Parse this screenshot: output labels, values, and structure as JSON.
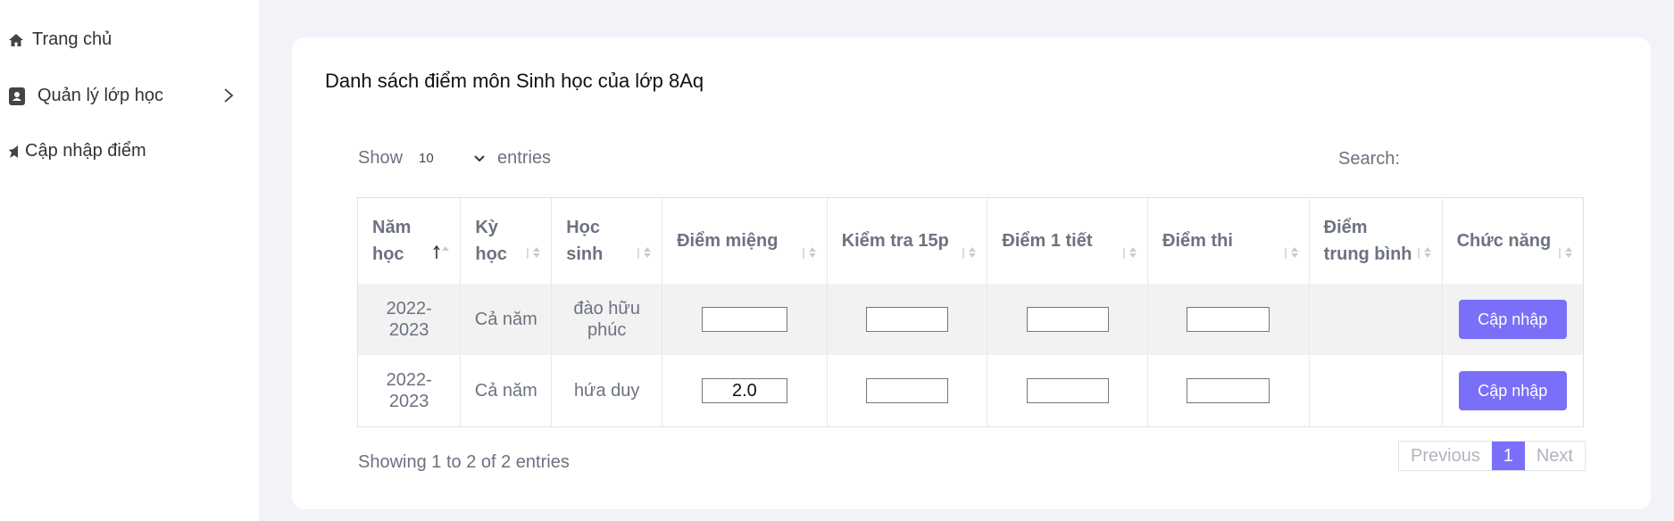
{
  "sidebar": {
    "items": [
      {
        "label": "Trang chủ",
        "icon": "home-icon"
      },
      {
        "label": "Quản lý lớp học",
        "icon": "contact-book-icon"
      },
      {
        "label": "Cập nhập điểm",
        "icon": "star-half-icon"
      }
    ]
  },
  "card": {
    "title": "Danh sách điểm môn Sinh học của lớp 8Aq"
  },
  "length": {
    "show_label": "Show",
    "value": "10",
    "entries_label": "entries"
  },
  "search": {
    "label": "Search:",
    "value": ""
  },
  "table": {
    "headers": [
      "Năm học",
      "Kỳ học",
      "Học sinh",
      "Điểm miệng",
      "Kiểm tra 15p",
      "Điểm 1 tiết",
      "Điểm thi",
      "Điểm trung bình",
      "Chức năng"
    ],
    "rows": [
      {
        "year": "2022-2023",
        "term": "Cả năm",
        "student": "đào hữu phúc",
        "oral": "",
        "test15": "",
        "test45": "",
        "exam": "",
        "average": "",
        "action": "Cập nhập"
      },
      {
        "year": "2022-2023",
        "term": "Cả năm",
        "student": "hứa duy",
        "oral": "2.0",
        "test15": "",
        "test45": "",
        "exam": "",
        "average": "",
        "action": "Cập nhập"
      }
    ]
  },
  "footer": {
    "info": "Showing 1 to 2 of 2 entries",
    "previous": "Previous",
    "page": "1",
    "next": "Next"
  },
  "colors": {
    "accent": "#7a6ff8",
    "background": "#f2f2f8"
  }
}
